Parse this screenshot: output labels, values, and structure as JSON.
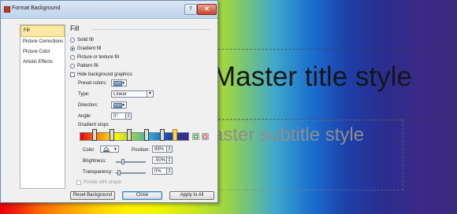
{
  "slide": {
    "title": "Master title style",
    "subtitle": "aster subtitle style"
  },
  "dialog": {
    "title": "Format Background",
    "help_glyph": "?",
    "close_glyph": "✕",
    "nav": [
      "Fill",
      "Picture Corrections",
      "Picture Color",
      "Artistic Effects"
    ],
    "fill": {
      "heading": "Fill",
      "options": [
        "Solid fill",
        "Gradient fill",
        "Picture or texture fill",
        "Pattern fill"
      ],
      "selected_option": "Gradient fill",
      "hide_graphics": "Hide background graphics",
      "preset_label": "Preset colors:",
      "type_label": "Type:",
      "type_value": "Linear",
      "direction_label": "Direction:",
      "angle_label": "Angle:",
      "angle_value": "0°",
      "stops_label": "Gradient stops",
      "color_label": "Color",
      "position_label": "Position:",
      "position_value": "89%",
      "brightness_label": "Brightness:",
      "brightness_value": "-50%",
      "transparency_label": "Transparency:",
      "transparency_value": "0%",
      "rotate_label": "Rotate with shape"
    },
    "buttons": {
      "reset": "Reset Background",
      "close": "Close",
      "apply_all": "Apply to All"
    },
    "icons": {
      "add_stop": "add-gradient-stop-icon",
      "remove_stop": "remove-gradient-stop-icon",
      "paint_bucket": "paint-bucket-icon"
    },
    "colors": {
      "selected_nav_bg": "#fde9a5",
      "title_bar": "#c8daf0",
      "close_button": "#c7422a"
    }
  }
}
